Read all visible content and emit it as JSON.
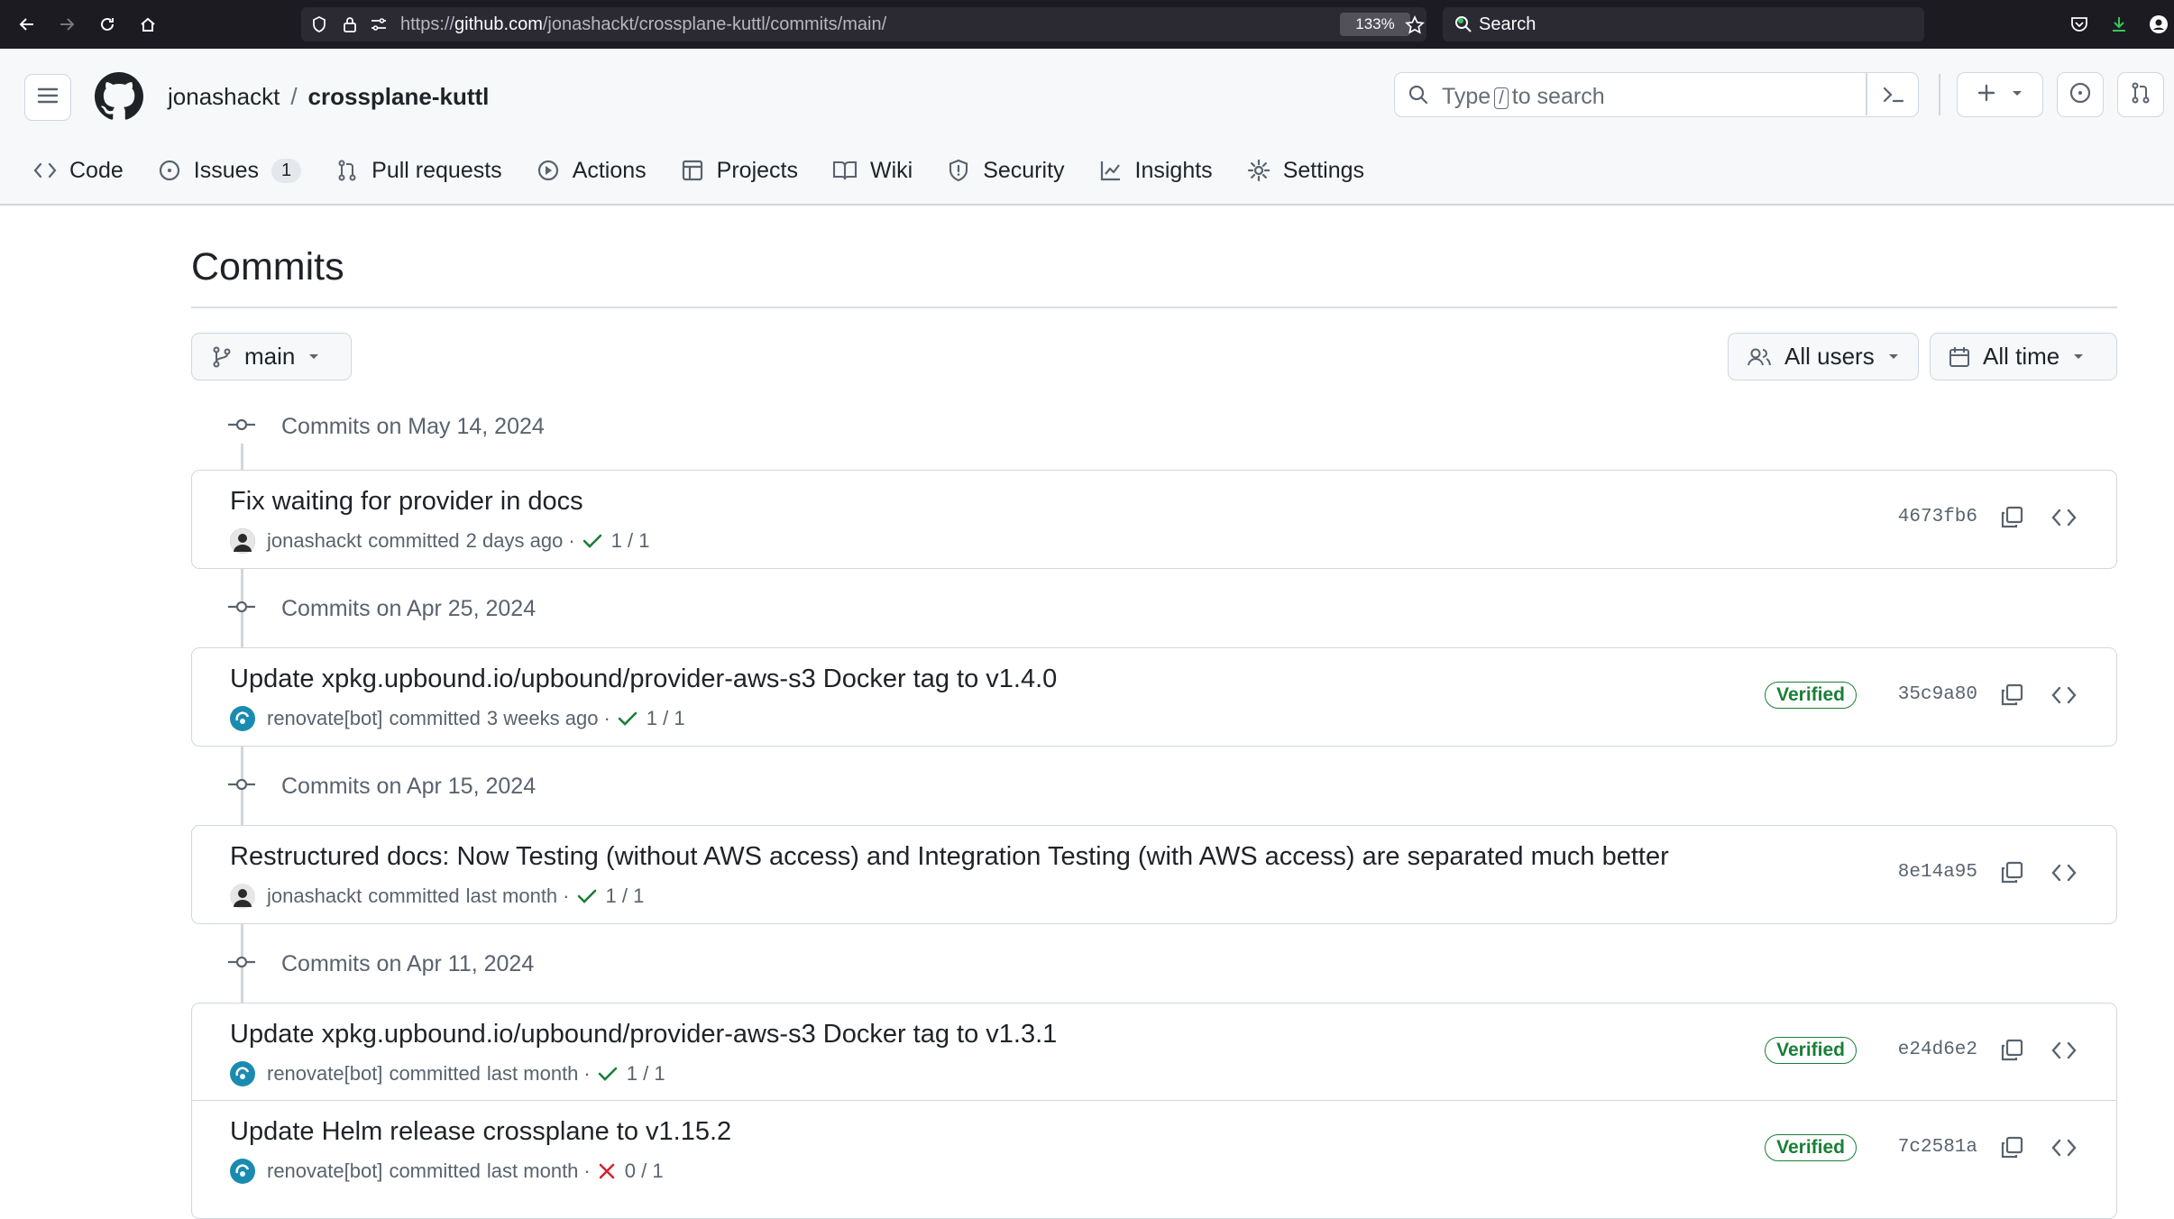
{
  "browser": {
    "url_prefix": "https://",
    "url_domain": "github.com",
    "url_path": "/jonashackt/crossplane-kuttl/commits/main/",
    "zoom": "133%",
    "search_placeholder": "Search"
  },
  "header": {
    "owner": "jonashackt",
    "separator": "/",
    "repo": "crossplane-kuttl",
    "search_prefix": "Type",
    "search_key": "/",
    "search_suffix": "to search"
  },
  "tabs": [
    {
      "label": "Code",
      "icon": "code-icon"
    },
    {
      "label": "Issues",
      "icon": "issue-icon",
      "count": "1"
    },
    {
      "label": "Pull requests",
      "icon": "pull-request-icon"
    },
    {
      "label": "Actions",
      "icon": "play-icon"
    },
    {
      "label": "Projects",
      "icon": "table-icon"
    },
    {
      "label": "Wiki",
      "icon": "book-icon"
    },
    {
      "label": "Security",
      "icon": "shield-icon"
    },
    {
      "label": "Insights",
      "icon": "graph-icon"
    },
    {
      "label": "Settings",
      "icon": "gear-icon"
    }
  ],
  "page": {
    "title": "Commits",
    "branch": "main",
    "users_filter": "All users",
    "time_filter": "All time"
  },
  "groups": [
    {
      "date_label": "Commits on May 14, 2024",
      "commits": [
        {
          "title": "Fix waiting for provider in docs",
          "author": "jonashackt",
          "action": "committed",
          "time": "2 days ago",
          "status": "success",
          "checks": "1 / 1",
          "verified": "",
          "sha": "4673fb6"
        }
      ]
    },
    {
      "date_label": "Commits on Apr 25, 2024",
      "commits": [
        {
          "title": "Update xpkg.upbound.io/upbound/provider-aws-s3 Docker tag to v1.4.0",
          "author": "renovate[bot]",
          "action": "committed",
          "time": "3 weeks ago",
          "status": "success",
          "checks": "1 / 1",
          "verified": "Verified",
          "sha": "35c9a80"
        }
      ]
    },
    {
      "date_label": "Commits on Apr 15, 2024",
      "commits": [
        {
          "title": "Restructured docs: Now Testing (without AWS access) and Integration Testing (with AWS access) are separated much better",
          "author": "jonashackt",
          "action": "committed",
          "time": "last month",
          "status": "success",
          "checks": "1 / 1",
          "verified": "",
          "sha": "8e14a95"
        }
      ]
    },
    {
      "date_label": "Commits on Apr 11, 2024",
      "commits": [
        {
          "title": "Update xpkg.upbound.io/upbound/provider-aws-s3 Docker tag to v1.3.1",
          "author": "renovate[bot]",
          "action": "committed",
          "time": "last month",
          "status": "success",
          "checks": "1 / 1",
          "verified": "Verified",
          "sha": "e24d6e2"
        },
        {
          "title": "Update Helm release crossplane to v1.15.2",
          "author": "renovate[bot]",
          "action": "committed",
          "time": "last month",
          "status": "failure",
          "checks": "0 / 1",
          "verified": "Verified",
          "sha": "7c2581a"
        }
      ]
    }
  ],
  "colors": {
    "success": "#1a7f37",
    "failure": "#d1242f",
    "muted": "#59636e",
    "border": "#d0d7de"
  }
}
